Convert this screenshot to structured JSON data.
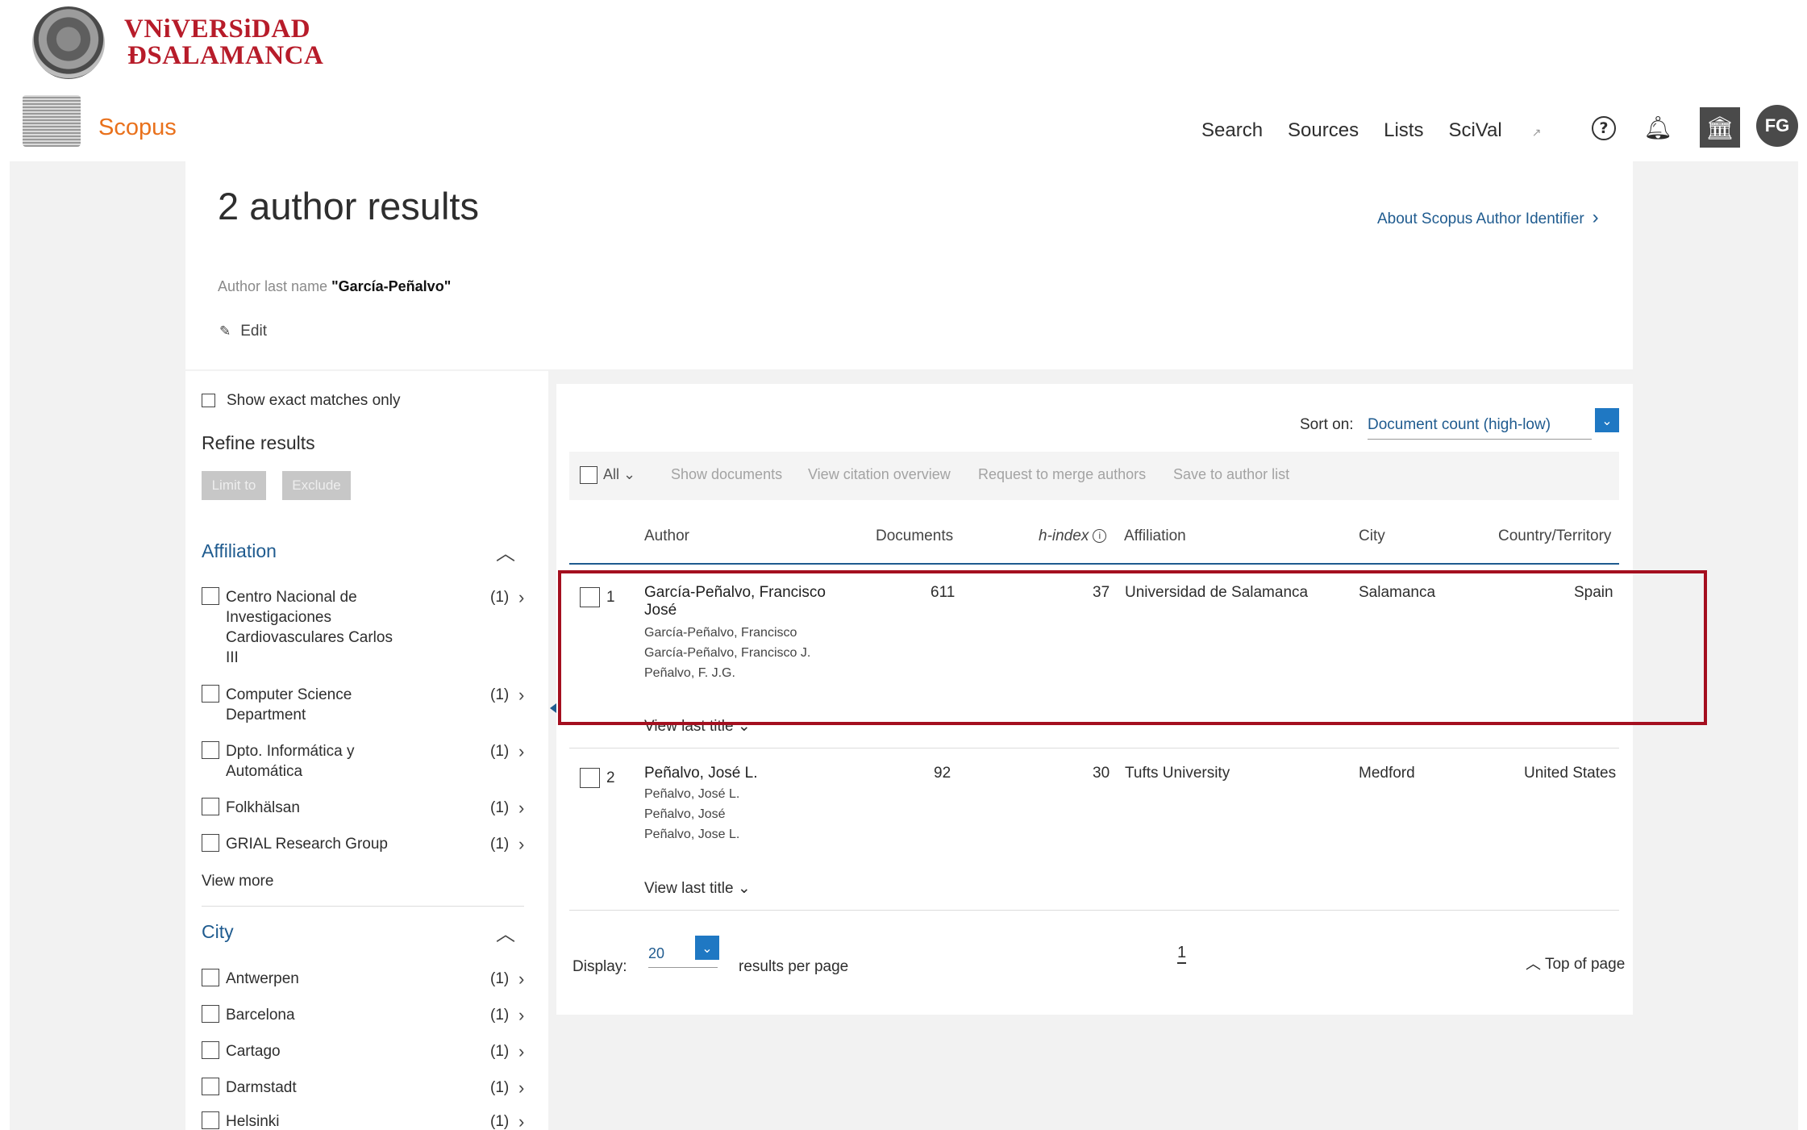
{
  "university": {
    "name_line1": "VNiVERSiDAD",
    "name_line2": "ÐSALAMANCA"
  },
  "app": {
    "name": "Scopus"
  },
  "nav": {
    "items": [
      "Search",
      "Sources",
      "Lists",
      "SciVal"
    ],
    "scival_ext_icon": "external-link-icon"
  },
  "header_icons": {
    "help": "?",
    "bell": "bell-icon",
    "institution": "institution-icon",
    "avatar": "FG"
  },
  "page": {
    "title": "2 author results",
    "about_link": "About Scopus Author Identifier",
    "query_label": "Author last name",
    "query_value": "\"García-Peñalvo\"",
    "edit_label": "Edit"
  },
  "refine": {
    "exact_matches": "Show exact matches only",
    "title": "Refine results",
    "limit_to": "Limit to",
    "exclude": "Exclude",
    "affiliation": {
      "heading": "Affiliation",
      "items": [
        {
          "label": "Centro Nacional de Investigaciones Cardiovasculares Carlos III",
          "count": "(1)"
        },
        {
          "label": "Computer Science Department",
          "count": "(1)"
        },
        {
          "label": "Dpto. Informática y Automática",
          "count": "(1)"
        },
        {
          "label": "Folkhälsan",
          "count": "(1)"
        },
        {
          "label": "GRIAL Research Group",
          "count": "(1)"
        }
      ],
      "view_more": "View more"
    },
    "city": {
      "heading": "City",
      "items": [
        {
          "label": "Antwerpen",
          "count": "(1)"
        },
        {
          "label": "Barcelona",
          "count": "(1)"
        },
        {
          "label": "Cartago",
          "count": "(1)"
        },
        {
          "label": "Darmstadt",
          "count": "(1)"
        },
        {
          "label": "Helsinki",
          "count": "(1)"
        }
      ]
    }
  },
  "results": {
    "sort_label": "Sort on:",
    "sort_value": "Document count (high-low)",
    "all_label": "All",
    "actions": [
      "Show documents",
      "View citation overview",
      "Request to merge authors",
      "Save to author list"
    ],
    "columns": {
      "author": "Author",
      "documents": "Documents",
      "hindex": "h-index",
      "affiliation": "Affiliation",
      "city": "City",
      "country": "Country/Territory"
    },
    "rows": [
      {
        "num": "1",
        "name_line1": "García-Peñalvo, Francisco",
        "name_line2": "José",
        "variants": [
          "García-Peñalvo, Francisco",
          "García-Peñalvo, Francisco J.",
          "Peñalvo, F. J.G."
        ],
        "documents": "611",
        "hindex": "37",
        "affiliation": "Universidad de Salamanca",
        "city": "Salamanca",
        "country": "Spain",
        "view_last": "View last title"
      },
      {
        "num": "2",
        "name_line1": "Peñalvo, José L.",
        "variants": [
          "Peñalvo, José L.",
          "Peñalvo, José",
          "Peñalvo, Jose L."
        ],
        "documents": "92",
        "hindex": "30",
        "affiliation": "Tufts University",
        "city": "Medford",
        "country": "United States",
        "view_last": "View last title"
      }
    ],
    "display_label": "Display:",
    "display_value": "20",
    "per_page": "results per page",
    "page_number": "1",
    "top_of_page": "Top of page"
  },
  "colors": {
    "brand_orange": "#e9711c",
    "link_blue": "#1f5b8f",
    "univ_red": "#b71c2a",
    "highlight_red": "#a40f1f"
  }
}
